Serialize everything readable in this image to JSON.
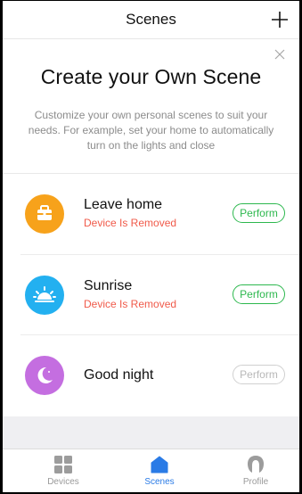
{
  "header": {
    "title": "Scenes",
    "add_icon": "plus-icon"
  },
  "intro": {
    "close_icon": "close-icon",
    "headline": "Create your Own Scene",
    "description": "Customize your own personal scenes to suit your needs. For example, set your home to automatically turn on the lights and close"
  },
  "scenes": [
    {
      "name": "Leave home",
      "status": "Device Is Removed",
      "action": "Perform",
      "icon": "toolbox-icon",
      "color": "#f7a21b"
    },
    {
      "name": "Sunrise",
      "status": "Device Is Removed",
      "action": "Perform",
      "icon": "sunrise-icon",
      "color": "#23b0f0"
    },
    {
      "name": "Good night",
      "status": "",
      "action": "Perform",
      "icon": "moon-icon",
      "color": "#c46ee0"
    }
  ],
  "colors": {
    "accent_green": "#2db84e",
    "error_red": "#f05a4a",
    "active_tab_blue": "#2a7be6"
  },
  "tabs": [
    {
      "label": "Devices",
      "icon": "grid-icon",
      "active": false
    },
    {
      "label": "Scenes",
      "icon": "home-icon",
      "active": true
    },
    {
      "label": "Profile",
      "icon": "profile-icon",
      "active": false
    }
  ]
}
